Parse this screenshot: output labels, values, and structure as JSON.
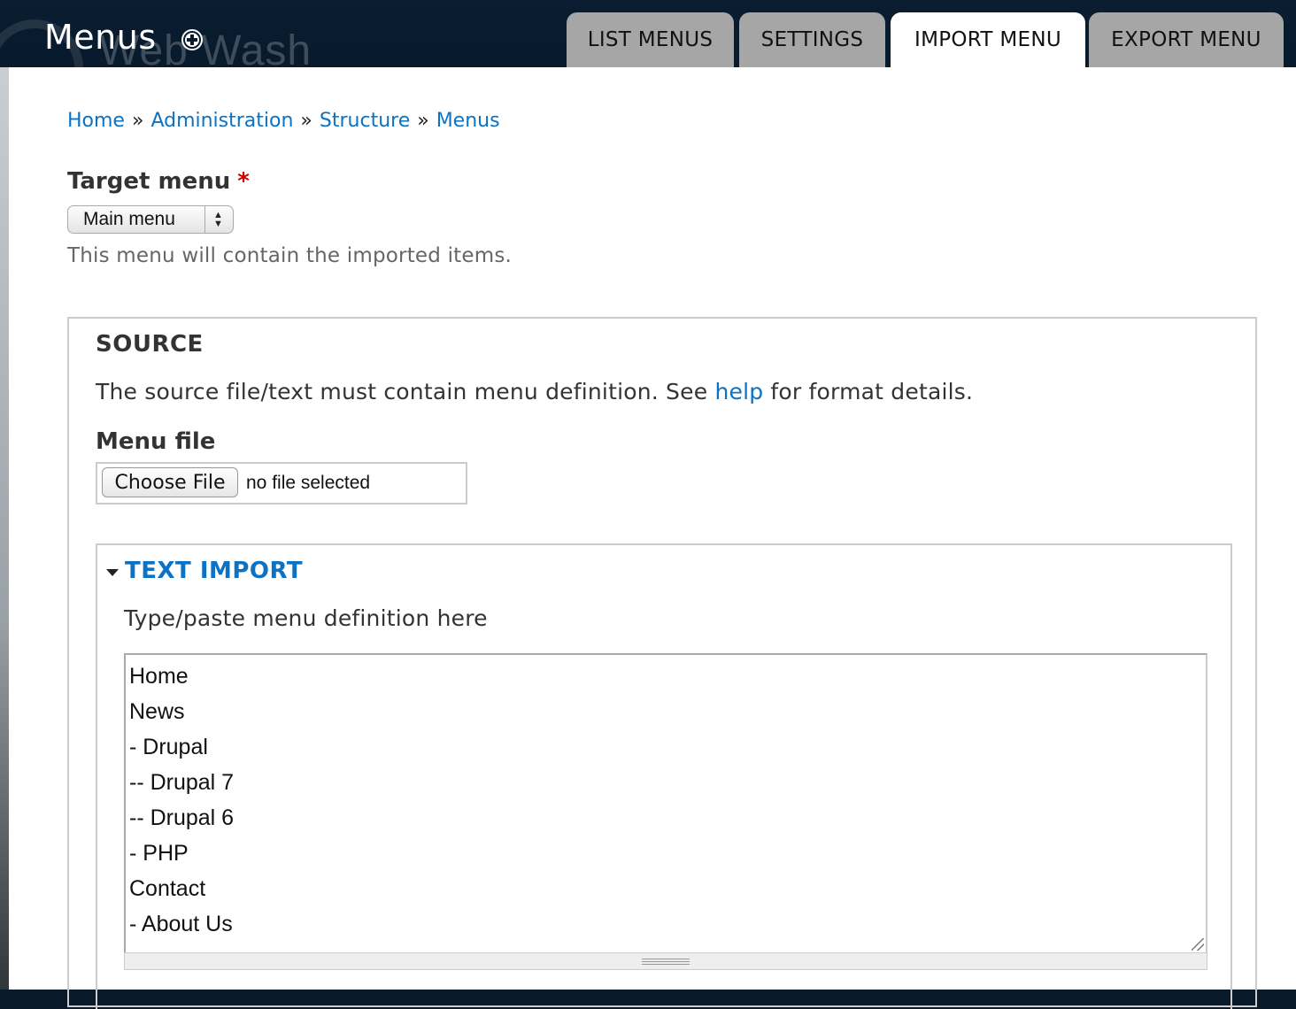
{
  "header": {
    "title": "Menus",
    "background_brand": "Web Wash",
    "add_shortcut_icon": "plus-circle-icon",
    "tabs": [
      {
        "label": "LIST MENUS",
        "active": false
      },
      {
        "label": "SETTINGS",
        "active": false
      },
      {
        "label": "IMPORT MENU",
        "active": true
      },
      {
        "label": "EXPORT MENU",
        "active": false
      }
    ]
  },
  "breadcrumb": {
    "items": [
      "Home",
      "Administration",
      "Structure",
      "Menus"
    ],
    "separator": "»"
  },
  "target_menu": {
    "label": "Target menu",
    "required_marker": "*",
    "selected": "Main menu",
    "description": "This menu will contain the imported items."
  },
  "source": {
    "legend": "SOURCE",
    "description_before": "The source file/text must contain menu definition. See ",
    "help_link": "help",
    "description_after": " for format details.",
    "menu_file": {
      "label": "Menu file",
      "button_label": "Choose File",
      "status": "no file selected"
    },
    "text_import": {
      "legend": "TEXT IMPORT",
      "expanded": true,
      "label": "Type/paste menu definition here",
      "lines": [
        "Home",
        "News",
        "- Drupal",
        "-- Drupal 7",
        "-- Drupal 6",
        "- PHP",
        "Contact",
        "- About Us"
      ]
    }
  },
  "colors": {
    "header_bg": "#081a2c",
    "tab_inactive": "#a6a6a6",
    "tab_active": "#ffffff",
    "link": "#0b72c4",
    "required": "#cc0000"
  }
}
